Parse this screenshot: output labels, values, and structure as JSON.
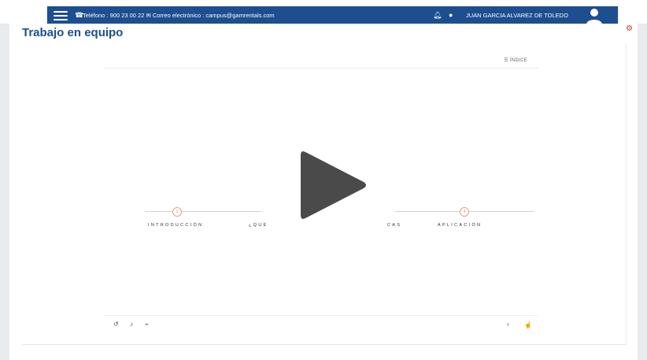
{
  "header": {
    "contact": "Teléfono : 900 23 00 22 ✉ Correo electrónico : campus@gamrentals.com",
    "user_name": "JUAN GARCIA ALVAREZ DE TOLEDO"
  },
  "page": {
    "title": "Trabajo en equipo"
  },
  "player": {
    "index_label": "☰ ÍNDICE",
    "node_1": "1",
    "node_2": "4",
    "sections": [
      "INTRODUCCIÓN",
      "¿QUÉ",
      "CAS",
      "APLICACIÓN"
    ]
  },
  "colors": {
    "navbar": "#1d4e8f",
    "title": "#1d4e8f",
    "accent": "#e0a090"
  },
  "icons": [
    "menu-icon",
    "phone-icon",
    "bell-icon",
    "chat-icon",
    "user-avatar-icon",
    "settings-icon",
    "play-icon",
    "rewind-icon",
    "volume-icon",
    "captions-icon",
    "back-icon",
    "cursor-icon"
  ]
}
